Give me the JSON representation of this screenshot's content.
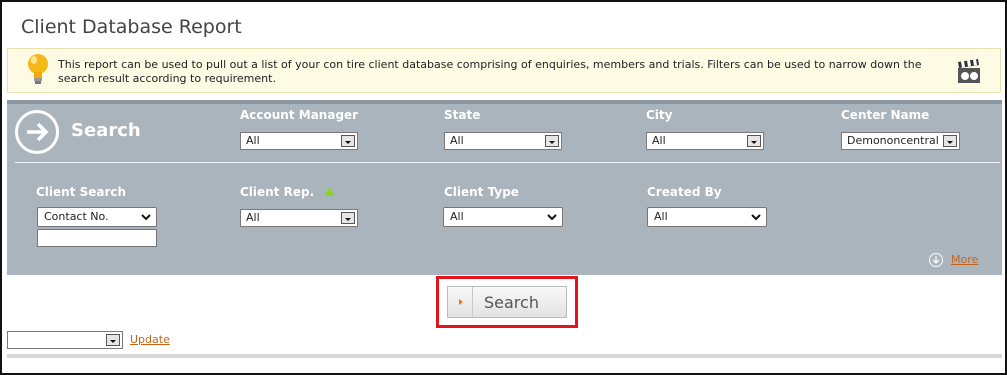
{
  "page": {
    "title": "Client Database Report",
    "info_text": "This report can be used to pull out a list of your con tire client database comprising of enquiries, members and trials. Filters can be used to narrow down the search result according to requirement."
  },
  "icons": {
    "info": "lightbulb-icon",
    "help": "clapperboard-icon",
    "search": "arrow-right-circle-icon",
    "more": "chevron-down-circle-icon",
    "sort": "triangle-up-icon"
  },
  "colors": {
    "panel_bg": "#a9b4bd",
    "link": "#c8641a",
    "highlight": "#e3141c",
    "accent_arrow": "#e77b1c",
    "sort_arrow": "#8fd12a"
  },
  "search_panel": {
    "title": "Search",
    "filters_row1": [
      {
        "label": "Account Manager",
        "value": "All"
      },
      {
        "label": "State",
        "value": "All"
      },
      {
        "label": "City",
        "value": "All"
      },
      {
        "label": "Center Name",
        "value": "Demononcentral"
      }
    ],
    "filters_row2": {
      "client_search": {
        "label": "Client Search",
        "value": "Contact No.",
        "text_value": ""
      },
      "client_rep": {
        "label": "Client Rep.",
        "value": "All"
      },
      "client_type": {
        "label": "Client Type",
        "value": "All"
      },
      "created_by": {
        "label": "Created By",
        "value": "All"
      }
    },
    "more_label": "More"
  },
  "actions": {
    "search_button": "Search",
    "bottom_select_value": "",
    "update_label": "Update"
  }
}
